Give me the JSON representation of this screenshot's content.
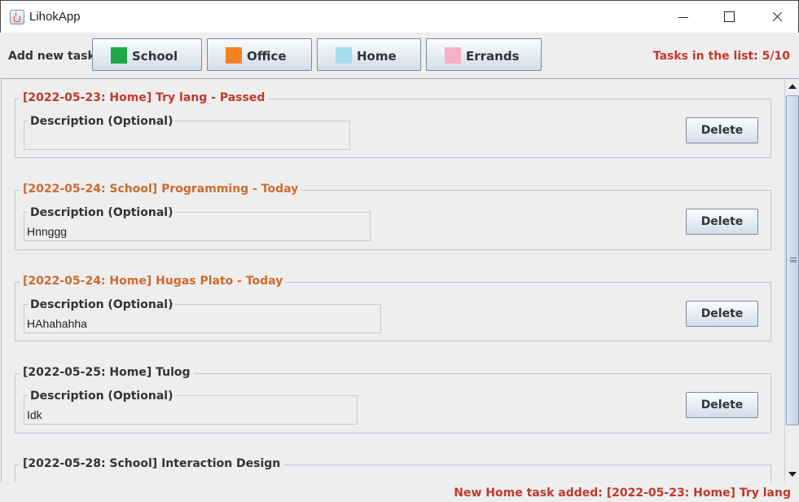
{
  "window": {
    "title": "LihokApp",
    "icon": "java-cup-icon"
  },
  "toolbar": {
    "add_label": "Add new task:",
    "buttons": [
      {
        "label": "School",
        "color": "#1fa845"
      },
      {
        "label": "Office",
        "color": "#f48220"
      },
      {
        "label": "Home",
        "color": "#a6dcee"
      },
      {
        "label": "Errands",
        "color": "#f8afc8"
      }
    ],
    "count_text": "Tasks in the list: 5/10"
  },
  "colors": {
    "passed": "#c0392b",
    "today": "#cf6a2e",
    "normal": "#333333",
    "status": "#c0392b"
  },
  "tasks": [
    {
      "title": "[2022-05-23: Home] Try lang - Passed",
      "state": "passed",
      "desc_label": "Description (Optional)",
      "desc_value": "",
      "delete_label": "Delete"
    },
    {
      "title": "[2022-05-24: School] Programming - Today",
      "state": "today",
      "desc_label": "Description (Optional)",
      "desc_value": "Hnnggg",
      "delete_label": "Delete"
    },
    {
      "title": "[2022-05-24: Home] Hugas Plato - Today",
      "state": "today",
      "desc_label": "Description (Optional)",
      "desc_value": "HAhahahha",
      "delete_label": "Delete"
    },
    {
      "title": "[2022-05-25: Home] Tulog",
      "state": "normal",
      "desc_label": "Description (Optional)",
      "desc_value": "Idk",
      "delete_label": "Delete"
    },
    {
      "title": "[2022-05-28: School] Interaction Design",
      "state": "normal",
      "desc_label": "",
      "desc_value": "",
      "delete_label": ""
    }
  ],
  "status": "New Home task added: [2022-05-23: Home] Try lang"
}
